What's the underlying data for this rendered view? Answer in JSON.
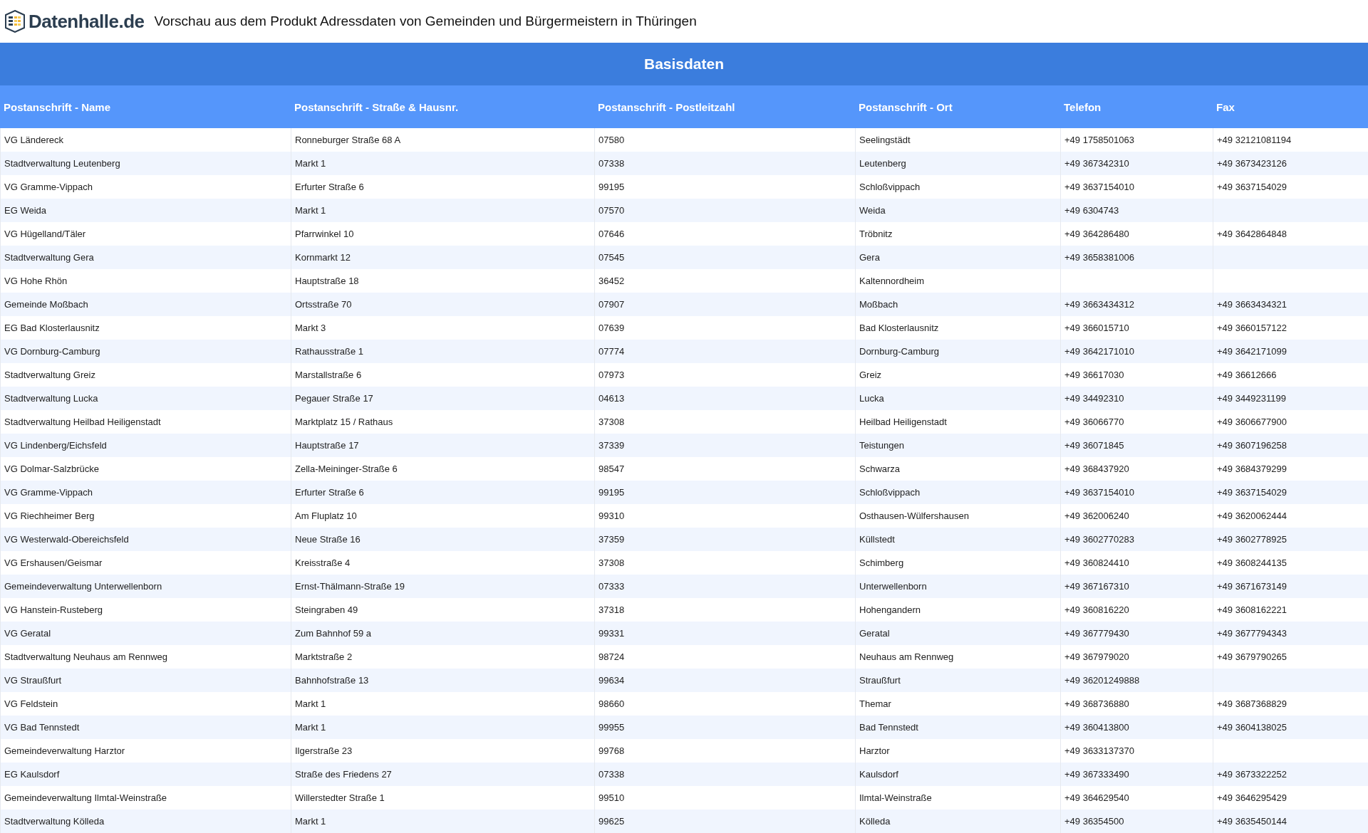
{
  "header": {
    "brand": "Datenhalle.de",
    "title": "Vorschau aus dem Produkt Adressdaten von Gemeinden und Bürgermeistern in Thüringen"
  },
  "table": {
    "section_title": "Basisdaten",
    "columns": [
      "Postanschrift - Name",
      "Postanschrift - Straße & Hausnr.",
      "Postanschrift - Postleitzahl",
      "Postanschrift - Ort",
      "Telefon",
      "Fax"
    ],
    "rows": [
      [
        "VG Ländereck",
        "Ronneburger Straße 68 A",
        "07580",
        "Seelingstädt",
        "+49 1758501063",
        "+49 32121081194"
      ],
      [
        "Stadtverwaltung Leutenberg",
        "Markt 1",
        "07338",
        "Leutenberg",
        "+49 367342310",
        "+49 3673423126"
      ],
      [
        "VG Gramme-Vippach",
        "Erfurter Straße 6",
        "99195",
        "Schloßvippach",
        "+49 3637154010",
        "+49 3637154029"
      ],
      [
        "EG Weida",
        "Markt 1",
        "07570",
        "Weida",
        "+49 6304743",
        null
      ],
      [
        "VG Hügelland/Täler",
        "Pfarrwinkel 10",
        "07646",
        "Tröbnitz",
        "+49 364286480",
        "+49 3642864848"
      ],
      [
        "Stadtverwaltung Gera",
        "Kornmarkt 12",
        "07545",
        "Gera",
        "+49 3658381006",
        null
      ],
      [
        "VG Hohe Rhön",
        "Hauptstraße 18",
        "36452",
        "Kaltennordheim",
        null,
        null
      ],
      [
        "Gemeinde Moßbach",
        "Ortsstraße 70",
        "07907",
        "Moßbach",
        "+49 3663434312",
        "+49 3663434321"
      ],
      [
        "EG Bad Klosterlausnitz",
        "Markt 3",
        "07639",
        "Bad Klosterlausnitz",
        "+49 366015710",
        "+49 3660157122"
      ],
      [
        "VG Dornburg-Camburg",
        "Rathausstraße 1",
        "07774",
        "Dornburg-Camburg",
        "+49 3642171010",
        "+49 3642171099"
      ],
      [
        "Stadtverwaltung Greiz",
        "Marstallstraße 6",
        "07973",
        "Greiz",
        "+49 36617030",
        "+49 36612666"
      ],
      [
        "Stadtverwaltung Lucka",
        "Pegauer Straße 17",
        "04613",
        "Lucka",
        "+49 34492310",
        "+49 3449231199"
      ],
      [
        "Stadtverwaltung Heilbad Heiligenstadt",
        "Marktplatz 15 / Rathaus",
        "37308",
        "Heilbad Heiligenstadt",
        "+49 36066770",
        "+49 3606677900"
      ],
      [
        "VG Lindenberg/Eichsfeld",
        "Hauptstraße 17",
        "37339",
        "Teistungen",
        "+49 36071845",
        "+49 3607196258"
      ],
      [
        "VG Dolmar-Salzbrücke",
        "Zella-Meininger-Straße 6",
        "98547",
        "Schwarza",
        "+49 368437920",
        "+49 3684379299"
      ],
      [
        "VG Gramme-Vippach",
        "Erfurter Straße 6",
        "99195",
        "Schloßvippach",
        "+49 3637154010",
        "+49 3637154029"
      ],
      [
        "VG Riechheimer Berg",
        "Am Fluplatz 10",
        "99310",
        "Osthausen-Wülfershausen",
        "+49 362006240",
        "+49 3620062444"
      ],
      [
        "VG Westerwald-Obereichsfeld",
        "Neue Straße 16",
        "37359",
        "Küllstedt",
        "+49 3602770283",
        "+49 3602778925"
      ],
      [
        "VG Ershausen/Geismar",
        "Kreisstraße 4",
        "37308",
        "Schimberg",
        "+49 360824410",
        "+49 3608244135"
      ],
      [
        "Gemeindeverwaltung Unterwellenborn",
        "Ernst-Thälmann-Straße 19",
        "07333",
        "Unterwellenborn",
        "+49 367167310",
        "+49 3671673149"
      ],
      [
        "VG Hanstein-Rusteberg",
        "Steingraben 49",
        "37318",
        "Hohengandern",
        "+49 360816220",
        "+49 3608162221"
      ],
      [
        "VG Geratal",
        "Zum Bahnhof 59 a",
        "99331",
        "Geratal",
        "+49 367779430",
        "+49 3677794343"
      ],
      [
        "Stadtverwaltung Neuhaus am Rennweg",
        "Marktstraße 2",
        "98724",
        "Neuhaus am Rennweg",
        "+49 367979020",
        "+49 3679790265"
      ],
      [
        "VG Straußfurt",
        "Bahnhofstraße 13",
        "99634",
        "Straußfurt",
        "+49 36201249888",
        null
      ],
      [
        "VG Feldstein",
        "Markt 1",
        "98660",
        "Themar",
        "+49 368736880",
        "+49 3687368829"
      ],
      [
        "VG Bad Tennstedt",
        "Markt 1",
        "99955",
        "Bad Tennstedt",
        "+49 360413800",
        "+49 3604138025"
      ],
      [
        "Gemeindeverwaltung Harztor",
        "Ilgerstraße 23",
        "99768",
        "Harztor",
        "+49 3633137370",
        null
      ],
      [
        "EG Kaulsdorf",
        "Straße des Friedens 27",
        "07338",
        "Kaulsdorf",
        "+49 367333490",
        "+49 3673322252"
      ],
      [
        "Gemeindeverwaltung Ilmtal-Weinstraße",
        "Willerstedter Straße 1",
        "99510",
        "Ilmtal-Weinstraße",
        "+49 364629540",
        "+49 3646295429"
      ],
      [
        "Stadtverwaltung Kölleda",
        "Markt 1",
        "99625",
        "Kölleda",
        "+49 36354500",
        "+49 3635450144"
      ]
    ]
  }
}
